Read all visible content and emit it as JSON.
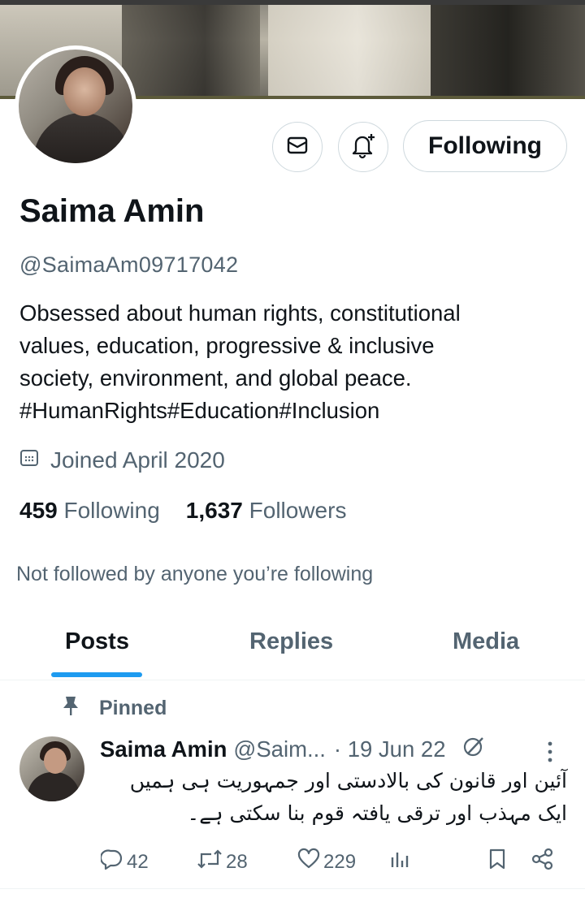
{
  "profile": {
    "name": "Saima Amin",
    "handle": "@SaimaAm09717042",
    "bio_lines": [
      "Obsessed about human rights, constitutional",
      "values, education, progressive & inclusive",
      "society, environment, and global peace.",
      "#HumanRights#Education#Inclusion"
    ],
    "joined": "Joined April 2020",
    "following_count": "459",
    "following_label": "Following",
    "followers_count": "1,637",
    "followers_label": "Followers",
    "not_followed_text": "Not followed by anyone you’re following",
    "follow_button_label": "Following"
  },
  "icons": {
    "mail": "mail-icon",
    "bell": "bell-plus-icon",
    "calendar": "calendar-icon",
    "pin": "pin-icon",
    "reply": "reply-icon",
    "retweet": "retweet-icon",
    "like": "heart-icon",
    "views": "views-icon",
    "bookmark": "bookmark-icon",
    "share": "share-icon",
    "more": "more-icon",
    "edited": "edited-icon"
  },
  "tabs": [
    {
      "label": "Posts",
      "active": true
    },
    {
      "label": "Replies",
      "active": false
    },
    {
      "label": "Media",
      "active": false
    }
  ],
  "pinned_post": {
    "pinned_label": "Pinned",
    "author_name": "Saima Amin",
    "author_handle": "@Saim...",
    "date": "· 19 Jun 22",
    "text_lines": [
      "آئین اور قانون کی بالادستی اور جمہوریت ہی ہمیں",
      "ایک مہذب اور ترقی یافتہ قوم بنا سکتی ہے۔"
    ],
    "replies": "42",
    "retweets": "28",
    "likes": "229"
  },
  "colors": {
    "text_primary": "#0f1419",
    "text_secondary": "#536471",
    "accent": "#1d9bf0",
    "border": "#cfd9de"
  }
}
